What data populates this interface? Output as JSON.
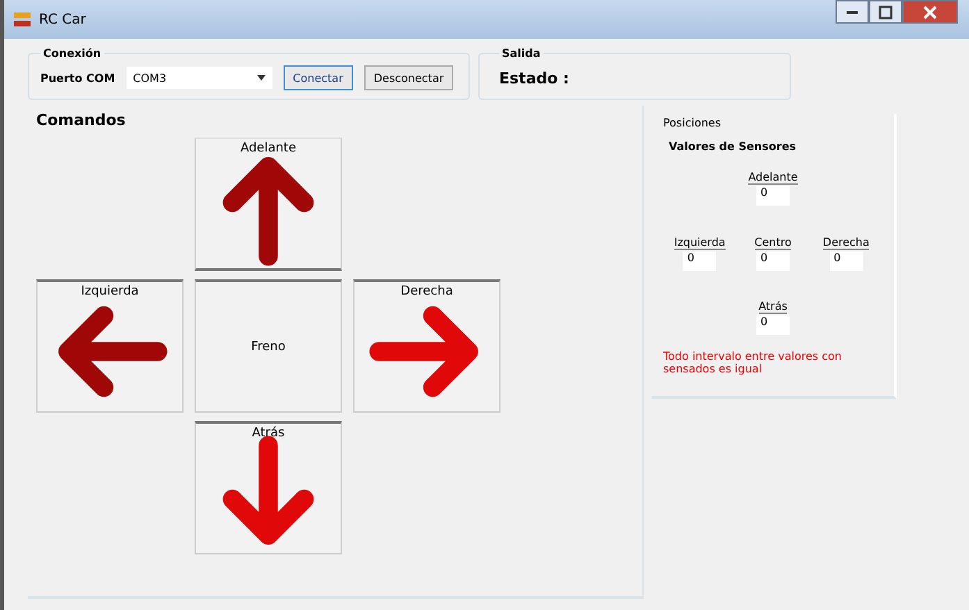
{
  "window": {
    "title": "RC Car"
  },
  "connection": {
    "title": "Conexión",
    "port_label": "Puerto COM",
    "port_value": "COM3",
    "buttons": [
      {
        "label": "Conectar",
        "focused": true
      },
      {
        "label": "Desconectar",
        "focused": false
      }
    ]
  },
  "output": {
    "title": "Salida",
    "status": "Estado :"
  },
  "commands": {
    "title": "Comandos",
    "buttons": [
      {
        "kind": "up",
        "label": "Adelante"
      },
      {
        "kind": "left",
        "label": "Izquierda"
      },
      {
        "kind": "center",
        "label": "Freno"
      },
      {
        "kind": "right",
        "label": "Derecha"
      },
      {
        "kind": "down",
        "label": "Atrás"
      }
    ]
  },
  "positions": {
    "title": "Posiciones",
    "subtitle": "Valores de Sensores",
    "fields": [
      {
        "kind": "top",
        "label": "Adelante",
        "value": "0"
      },
      {
        "kind": "left",
        "label": "Izquierda",
        "value": "0"
      },
      {
        "kind": "middle",
        "label": "Centro",
        "value": "0"
      },
      {
        "kind": "right",
        "label": "Derecha",
        "value": "0"
      },
      {
        "kind": "bottom",
        "label": "Atrás",
        "value": "0"
      }
    ],
    "warning": "Todo intervalo entre valores con sensados es igual"
  }
}
